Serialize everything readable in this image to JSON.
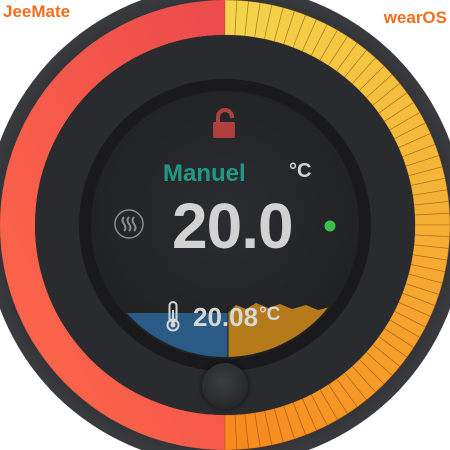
{
  "branding": {
    "left": "JeeMate",
    "right": "wearOS"
  },
  "thermostat": {
    "mode_label": "Manuel",
    "unit": "°C",
    "setpoint": "20.0",
    "current_temperature": "20.08",
    "current_unit": "°C",
    "lock_state": "unlocked",
    "status": "online"
  },
  "icons": {
    "lock": "lock-open-icon",
    "heat": "heat-wave-icon",
    "status": "status-dot-icon",
    "thermometer": "thermometer-icon"
  },
  "colors": {
    "brand": "#f26d1d",
    "ring_red": "#ef4f4b",
    "ring_orange": "#f7891e",
    "ring_yellow": "#f4d54a",
    "mode_text": "#1f9a88",
    "setpoint_text": "#d2d2d2",
    "current_text": "#d7d7d7",
    "lock": "#b04040",
    "status_dot": "#39c14b",
    "cold_fill": "#2a5a86",
    "warm_fill": "#b57a1a"
  }
}
